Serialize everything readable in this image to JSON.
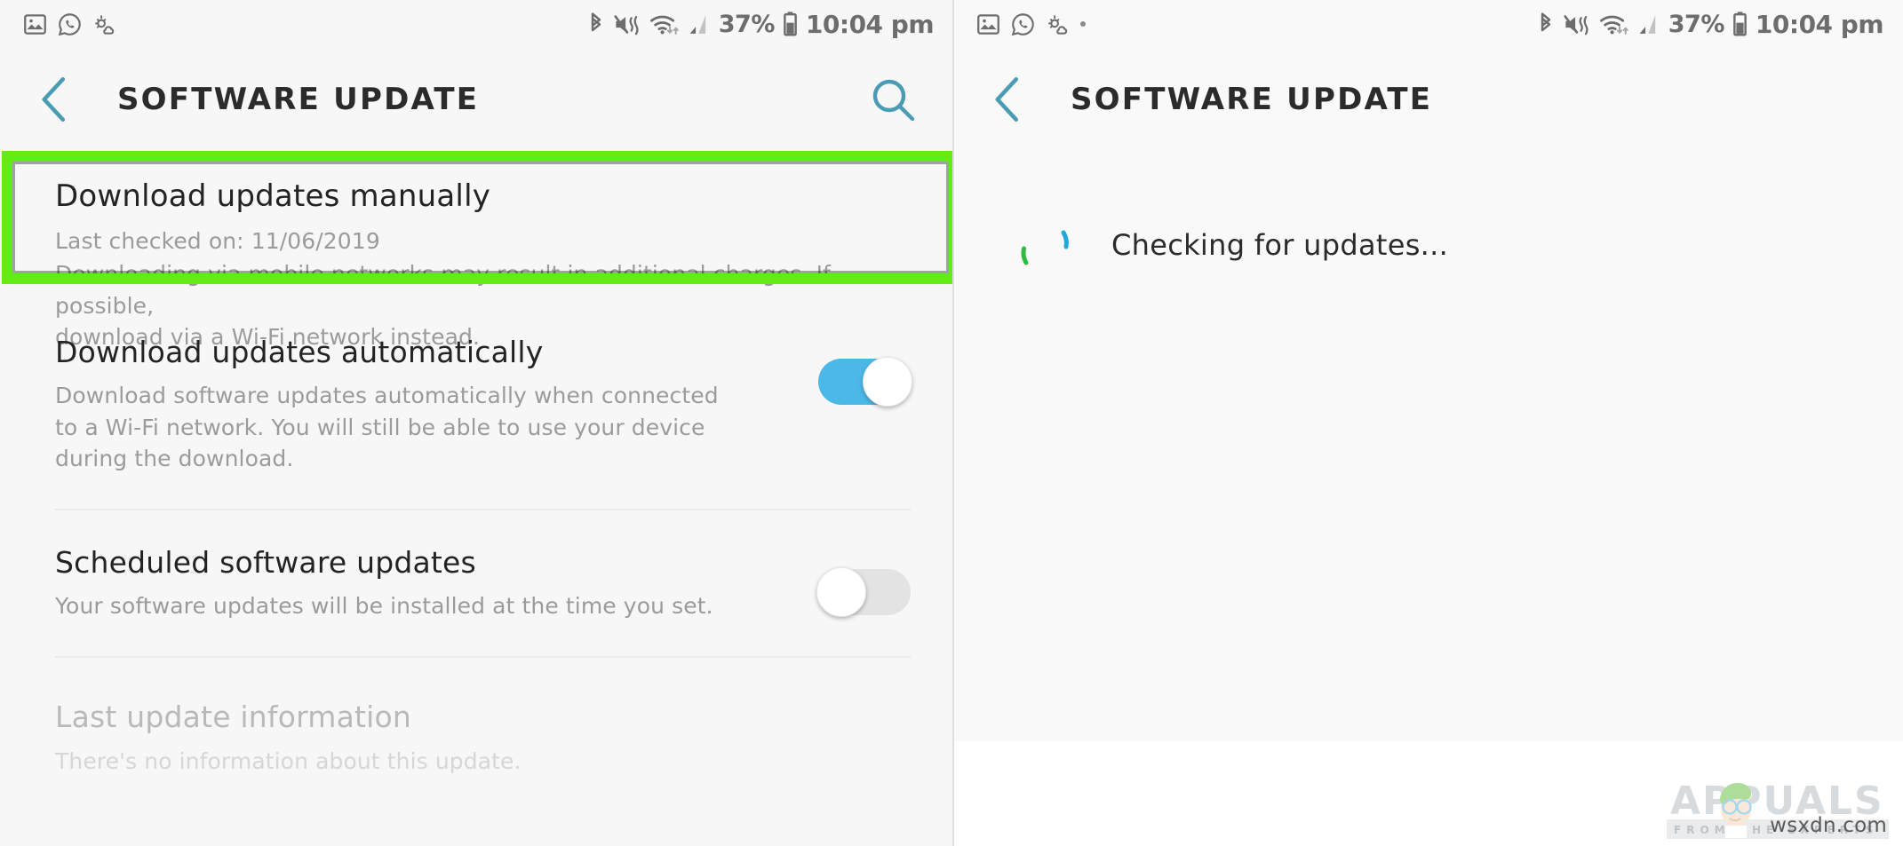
{
  "left_panel": {
    "statusbar": {
      "icons_left": [
        "gallery-icon",
        "whatsapp-icon",
        "weather-icon"
      ],
      "icons_right": [
        "bluetooth-icon",
        "vibrate-mute-icon",
        "wifi-icon",
        "signal-icon"
      ],
      "battery_percent": "37%",
      "time": "10:04 pm"
    },
    "appbar": {
      "back_label": "back-chevron",
      "title": "SOFTWARE UPDATE",
      "search_label": "search-icon"
    },
    "rows": [
      {
        "title": "Download updates manually",
        "desc_line1": "Last checked on: 11/06/2019",
        "desc_line2": "Downloading via mobile networks may result in additional charges. If possible,\ndownload via a Wi-Fi network instead.",
        "highlighted": true
      },
      {
        "title": "Download updates automatically",
        "desc": "Download software updates automatically when connected\nto a Wi-Fi network. You will still be able to use your device\nduring the download.",
        "toggle": "on"
      },
      {
        "title": "Scheduled software updates",
        "desc": "Your software updates will be installed at the time you set.",
        "toggle": "off"
      }
    ],
    "last_section": {
      "title": "Last update information",
      "desc": "There's no information about this update."
    }
  },
  "right_panel": {
    "statusbar": {
      "icons_left": [
        "gallery-icon",
        "whatsapp-icon",
        "weather-icon",
        "dot-icon"
      ],
      "icons_right": [
        "bluetooth-icon",
        "vibrate-mute-icon",
        "wifi-icon",
        "signal-icon"
      ],
      "battery_percent": "37%",
      "time": "10:04 pm"
    },
    "appbar": {
      "back_label": "back-chevron",
      "title": "SOFTWARE UPDATE"
    },
    "status": {
      "message": "Checking for updates...",
      "spinner": "loading-spinner"
    }
  },
  "watermark": {
    "brand": "APPUALS",
    "tagline": "FROM THE EXPERTS",
    "url": "wsxdn.com"
  },
  "colors": {
    "accent_teal": "#4a9cb5",
    "toggle_on": "#4cb8e8",
    "highlight_green": "#63eb16",
    "spinner_green": "#2fbb3e",
    "spinner_blue": "#22a7dd",
    "title_text": "#232323",
    "desc_text": "#9b9b9b"
  }
}
